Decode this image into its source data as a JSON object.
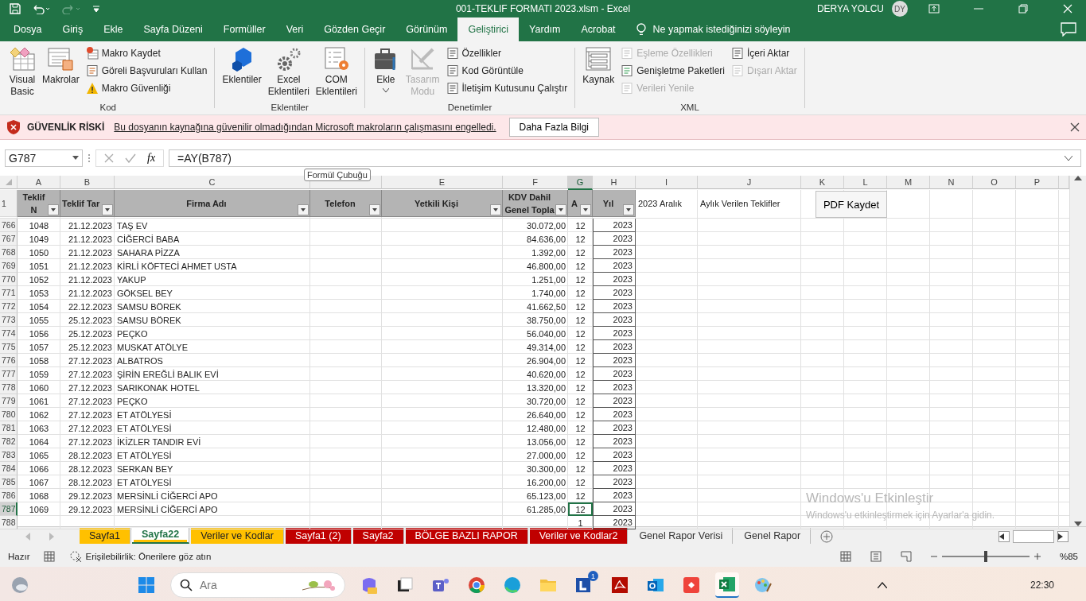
{
  "window": {
    "title": "001-TEKLIF FORMATI 2023.xlsm  -  Excel",
    "user": "DERYA YOLCU",
    "initials": "DY"
  },
  "ribbon_tabs": [
    {
      "label": "Dosya",
      "selected": false
    },
    {
      "label": "Giriş",
      "selected": false
    },
    {
      "label": "Ekle",
      "selected": false
    },
    {
      "label": "Sayfa Düzeni",
      "selected": false
    },
    {
      "label": "Formüller",
      "selected": false
    },
    {
      "label": "Veri",
      "selected": false
    },
    {
      "label": "Gözden Geçir",
      "selected": false
    },
    {
      "label": "Görünüm",
      "selected": false
    },
    {
      "label": "Geliştirici",
      "selected": true
    },
    {
      "label": "Yardım",
      "selected": false
    },
    {
      "label": "Acrobat",
      "selected": false
    }
  ],
  "tell_me": "Ne yapmak istediğinizi söyleyin",
  "ribbon_groups": [
    {
      "label": "Kod",
      "items": [
        {
          "kind": "large",
          "label": "Visual\nBasic",
          "disabled": false,
          "dropdown": false
        },
        {
          "kind": "large",
          "label": "Makrolar",
          "disabled": false,
          "dropdown": false
        },
        {
          "kind": "stack",
          "items": [
            {
              "label": "Makro Kaydet",
              "disabled": false
            },
            {
              "label": "Göreli Başvuruları Kullan",
              "disabled": false
            },
            {
              "label": "Makro Güvenliği",
              "disabled": false
            }
          ]
        }
      ]
    },
    {
      "label": "Eklentiler",
      "items": [
        {
          "kind": "large",
          "label": "Eklentiler",
          "disabled": false,
          "dropdown": false
        },
        {
          "kind": "large",
          "label": "Excel\nEklentileri",
          "disabled": false,
          "dropdown": false
        },
        {
          "kind": "large",
          "label": "COM\nEklentileri",
          "disabled": false,
          "dropdown": false
        }
      ]
    },
    {
      "label": "Denetimler",
      "items": [
        {
          "kind": "large",
          "label": "Ekle",
          "disabled": false,
          "dropdown": true
        },
        {
          "kind": "large",
          "label": "Tasarım\nModu",
          "disabled": true,
          "dropdown": false
        },
        {
          "kind": "stack",
          "items": [
            {
              "label": "Özellikler",
              "disabled": false
            },
            {
              "label": "Kod Görüntüle",
              "disabled": false
            },
            {
              "label": "İletişim Kutusunu Çalıştır",
              "disabled": false
            }
          ]
        }
      ]
    },
    {
      "label": "XML",
      "items": [
        {
          "kind": "large",
          "label": "Kaynak",
          "disabled": false,
          "dropdown": false
        },
        {
          "kind": "stack",
          "items": [
            {
              "label": "Eşleme Özellikleri",
              "disabled": true
            },
            {
              "label": "Genişletme Paketleri",
              "disabled": false
            },
            {
              "label": "Verileri Yenile",
              "disabled": true
            }
          ]
        },
        {
          "kind": "stack",
          "items": [
            {
              "label": "İçeri Aktar",
              "disabled": false
            },
            {
              "label": "Dışarı Aktar",
              "disabled": true
            }
          ]
        }
      ]
    }
  ],
  "security_bar": {
    "title": "GÜVENLİK RİSKİ",
    "message": "Bu dosyanın kaynağına güvenilir olmadığından Microsoft makroların çalışmasını engelledi.",
    "button": "Daha Fazla Bilgi"
  },
  "formula_bar": {
    "name_box": "G787",
    "insert_function": "fx",
    "formula": "=AY(B787)",
    "tooltip": "Formül Çubuğu"
  },
  "columns": [
    {
      "letter": "A",
      "selected": false
    },
    {
      "letter": "B",
      "selected": false
    },
    {
      "letter": "C",
      "selected": false
    },
    {
      "selected": false
    },
    {
      "letter": "E",
      "selected": false
    },
    {
      "letter": "F",
      "selected": false
    },
    {
      "letter": "G",
      "selected": true
    },
    {
      "letter": "H",
      "selected": false
    },
    {
      "letter": "I",
      "selected": false
    },
    {
      "letter": "J",
      "selected": false
    },
    {
      "letter": "K",
      "selected": false
    },
    {
      "letter": "L",
      "selected": false
    },
    {
      "letter": "M",
      "selected": false
    },
    {
      "letter": "N",
      "selected": false
    },
    {
      "letter": "O",
      "selected": false
    },
    {
      "letter": "P",
      "selected": false
    }
  ],
  "header_row": {
    "row": "1",
    "headers": [
      "Teklif N",
      "Teklif Tar",
      "Firma Adı",
      "Telefon",
      "Yetkili Kişi",
      "KDV Dahil\nGenel Topla",
      "A",
      "Yıl"
    ],
    "period": "2023 Aralık",
    "report_title": "Aylık Verilen Teklifler",
    "pdf_button": "PDF Kaydet"
  },
  "rows": [
    {
      "row": "766",
      "teklif_no": "1048",
      "tarih": "21.12.2023",
      "firma": "TAŞ EV",
      "toplam": "30.072,00",
      "ay": "12",
      "yil": "2023",
      "selected": false
    },
    {
      "row": "767",
      "teklif_no": "1049",
      "tarih": "21.12.2023",
      "firma": "CİĞERCİ BABA",
      "toplam": "84.636,00",
      "ay": "12",
      "yil": "2023",
      "selected": false
    },
    {
      "row": "768",
      "teklif_no": "1050",
      "tarih": "21.12.2023",
      "firma": "SAHARA PİZZA",
      "toplam": "1.392,00",
      "ay": "12",
      "yil": "2023",
      "selected": false
    },
    {
      "row": "769",
      "teklif_no": "1051",
      "tarih": "21.12.2023",
      "firma": "KİRLİ KÖFTECİ AHMET USTA",
      "toplam": "46.800,00",
      "ay": "12",
      "yil": "2023",
      "selected": false
    },
    {
      "row": "770",
      "teklif_no": "1052",
      "tarih": "21.12.2023",
      "firma": "YAKUP",
      "toplam": "1.251,00",
      "ay": "12",
      "yil": "2023",
      "selected": false
    },
    {
      "row": "771",
      "teklif_no": "1053",
      "tarih": "21.12.2023",
      "firma": "GÖKSEL BEY",
      "toplam": "1.740,00",
      "ay": "12",
      "yil": "2023",
      "selected": false
    },
    {
      "row": "772",
      "teklif_no": "1054",
      "tarih": "22.12.2023",
      "firma": "SAMSU BÖREK",
      "toplam": "41.662,50",
      "ay": "12",
      "yil": "2023",
      "selected": false
    },
    {
      "row": "773",
      "teklif_no": "1055",
      "tarih": "25.12.2023",
      "firma": "SAMSU BÖREK",
      "toplam": "38.750,00",
      "ay": "12",
      "yil": "2023",
      "selected": false
    },
    {
      "row": "774",
      "teklif_no": "1056",
      "tarih": "25.12.2023",
      "firma": "PEÇKO",
      "toplam": "56.040,00",
      "ay": "12",
      "yil": "2023",
      "selected": false
    },
    {
      "row": "775",
      "teklif_no": "1057",
      "tarih": "25.12.2023",
      "firma": "MUSKAT ATÖLYE",
      "toplam": "49.314,00",
      "ay": "12",
      "yil": "2023",
      "selected": false
    },
    {
      "row": "776",
      "teklif_no": "1058",
      "tarih": "27.12.2023",
      "firma": "ALBATROS",
      "toplam": "26.904,00",
      "ay": "12",
      "yil": "2023",
      "selected": false
    },
    {
      "row": "777",
      "teklif_no": "1059",
      "tarih": "27.12.2023",
      "firma": "ŞİRİN EREĞLİ BALIK EVİ",
      "toplam": "40.620,00",
      "ay": "12",
      "yil": "2023",
      "selected": false
    },
    {
      "row": "778",
      "teklif_no": "1060",
      "tarih": "27.12.2023",
      "firma": "SARIKONAK HOTEL",
      "toplam": "13.320,00",
      "ay": "12",
      "yil": "2023",
      "selected": false
    },
    {
      "row": "779",
      "teklif_no": "1061",
      "tarih": "27.12.2023",
      "firma": "PEÇKO",
      "toplam": "30.720,00",
      "ay": "12",
      "yil": "2023",
      "selected": false
    },
    {
      "row": "780",
      "teklif_no": "1062",
      "tarih": "27.12.2023",
      "firma": "ET ATÖLYESİ",
      "toplam": "26.640,00",
      "ay": "12",
      "yil": "2023",
      "selected": false
    },
    {
      "row": "781",
      "teklif_no": "1063",
      "tarih": "27.12.2023",
      "firma": "ET ATÖLYESİ",
      "toplam": "12.480,00",
      "ay": "12",
      "yil": "2023",
      "selected": false
    },
    {
      "row": "782",
      "teklif_no": "1064",
      "tarih": "27.12.2023",
      "firma": "İKİZLER TANDIR EVİ",
      "toplam": "13.056,00",
      "ay": "12",
      "yil": "2023",
      "selected": false
    },
    {
      "row": "783",
      "teklif_no": "1065",
      "tarih": "28.12.2023",
      "firma": "ET ATÖLYESİ",
      "toplam": "27.000,00",
      "ay": "12",
      "yil": "2023",
      "selected": false
    },
    {
      "row": "784",
      "teklif_no": "1066",
      "tarih": "28.12.2023",
      "firma": "SERKAN BEY",
      "toplam": "30.300,00",
      "ay": "12",
      "yil": "2023",
      "selected": false
    },
    {
      "row": "785",
      "teklif_no": "1067",
      "tarih": "28.12.2023",
      "firma": "ET ATÖLYESİ",
      "toplam": "16.200,00",
      "ay": "12",
      "yil": "2023",
      "selected": false
    },
    {
      "row": "786",
      "teklif_no": "1068",
      "tarih": "29.12.2023",
      "firma": "MERSİNLİ CİĞERCİ APO",
      "toplam": "65.123,00",
      "ay": "12",
      "yil": "2023",
      "selected": false
    },
    {
      "row": "787",
      "teklif_no": "1069",
      "tarih": "29.12.2023",
      "firma": "MERSİNLİ CİĞERCİ APO",
      "toplam": "61.285,00",
      "ay": "12",
      "yil": "2023",
      "selected": true
    },
    {
      "row": "788",
      "ay": "1",
      "yil": "2023",
      "selected": false
    }
  ],
  "activation": {
    "title": "Windows'u Etkinleştir",
    "message": "Windows'u etkinleştirmek için Ayarlar'a gidin."
  },
  "sheet_tabs": [
    {
      "label": "Sayfa1",
      "selected": false,
      "color": "#ffc000"
    },
    {
      "label": "Sayfa22",
      "selected": true,
      "color": "#ffc000"
    },
    {
      "label": "Veriler ve Kodlar",
      "selected": false,
      "color": "#ffc000"
    },
    {
      "label": "Sayfa1 (2)",
      "selected": false,
      "color": "#c00000"
    },
    {
      "label": "Sayfa2",
      "selected": false,
      "color": "#c00000"
    },
    {
      "label": "BÖLGE BAZLI RAPOR",
      "selected": false,
      "color": "#c00000"
    },
    {
      "label": "Veriler ve Kodlar2",
      "selected": false,
      "color": "#c00000"
    },
    {
      "label": "Genel Rapor Verisi",
      "selected": false
    },
    {
      "label": "Genel Rapor",
      "selected": false
    }
  ],
  "status_bar": {
    "mode": "Hazır",
    "accessibility": "Erişilebilirlik: Önerilere göz atın",
    "zoom": "%85",
    "level": 0.5
  },
  "taskbar": {
    "search_placeholder": "Ara",
    "badge": "1",
    "time": "22:30"
  }
}
